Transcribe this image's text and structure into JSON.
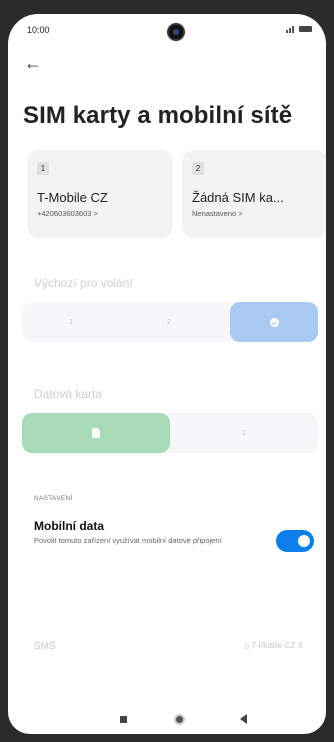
{
  "status_bar": {
    "time": "10:00",
    "icons": [
      "signal-icon",
      "battery-icon"
    ]
  },
  "header": {
    "back_icon": "back-arrow-icon",
    "title": "SIM karty a mobilní sítě"
  },
  "sim_cards": [
    {
      "slot": "1",
      "name": "T-Mobile CZ",
      "subtitle": "+420603603603 >"
    },
    {
      "slot": "2",
      "name": "Žádná SIM ka...",
      "subtitle": "Nenastaveno >"
    }
  ],
  "default_calls": {
    "label": "Výchozí pro volání",
    "options": [
      "1",
      "2",
      ""
    ],
    "selected": "check-icon"
  },
  "data_card": {
    "label": "Datová karta",
    "options": [
      "",
      "2"
    ],
    "selected": "sim-icon"
  },
  "settings": {
    "section": "NASTAVENÍ",
    "mobile_data_title": "Mobilní data",
    "mobile_data_desc": "Povolit tomuto zařízení využívat mobilní datové připojení",
    "mobile_data_enabled": true
  },
  "sms": {
    "label": "SMS",
    "value": "T-Mobile CZ"
  },
  "colors": {
    "toggle_on": "#0d7ee7",
    "calls_selected": "#a9cbf1",
    "data_selected": "#a8dcb9"
  },
  "nav": {
    "icons": [
      "recent-apps-icon",
      "home-icon",
      "back-icon"
    ]
  }
}
